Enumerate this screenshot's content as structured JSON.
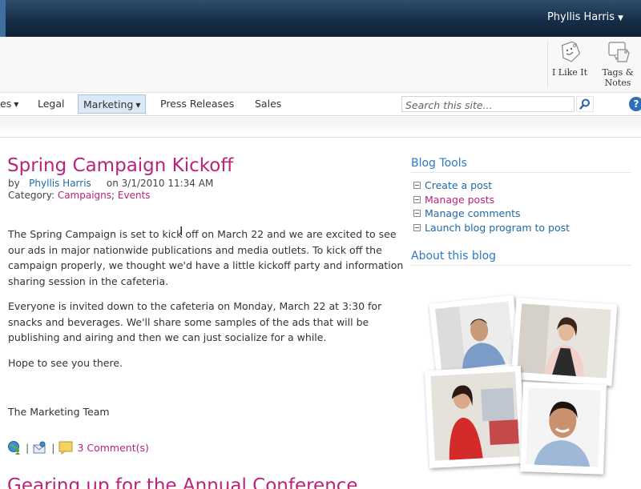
{
  "user": {
    "name": "Phyllis Harris"
  },
  "ribbon": {
    "like_label": "I Like It",
    "tags_line1": "Tags &",
    "tags_line2": "Notes"
  },
  "nav": {
    "items": [
      {
        "label": "es",
        "has_dropdown": true
      },
      {
        "label": "Legal",
        "has_dropdown": false
      },
      {
        "label": "Marketing",
        "has_dropdown": true,
        "selected": true
      },
      {
        "label": "Press Releases",
        "has_dropdown": false
      },
      {
        "label": "Sales",
        "has_dropdown": false
      }
    ]
  },
  "search": {
    "placeholder": "Search this site...",
    "help_label": "?"
  },
  "post": {
    "title": "Spring Campaign Kickoff",
    "by_label": "by",
    "author": "Phyllis Harris",
    "date_text": "on 3/1/2010 11:34 AM",
    "category_label": "Category:",
    "categories": [
      "Campaigns",
      "Events"
    ],
    "category_separator": ";",
    "paragraphs": [
      "The Spring Campaign is set to kick off on March 22 and we are excited to see our ads in major nationwide publications and media outlets. To kick off the campaign properly, we thought we'd have a little kickoff party and information sharing session in the cafeteria.",
      "Everyone is invited down to the cafeteria on Monday, March 22 at 3:30 for snacks and beverages. We'll share some samples of the ads that will be publishing and airing and then we can just socialize for a while.",
      "Hope to see you there."
    ],
    "signature": "The Marketing Team",
    "separator": "|",
    "comments_label": "3 Comment(s)"
  },
  "next_post": {
    "title": "Gearing up for the Annual Conference"
  },
  "sidebar": {
    "blog_tools_heading": "Blog Tools",
    "tools": [
      {
        "label": "Create a post",
        "color": "blue"
      },
      {
        "label": "Manage posts",
        "color": "pink"
      },
      {
        "label": "Manage comments",
        "color": "blue"
      },
      {
        "label": "Launch blog program to post",
        "color": "blue"
      }
    ],
    "about_heading": "About this blog"
  },
  "colors": {
    "accent_pink": "#b8247a",
    "link_blue": "#1f6aa5",
    "heading_blue": "#2f7ac0",
    "topbar": "#152c46",
    "nav_selected_bg": "#dbe9f6"
  },
  "icons": {
    "like": "tag-smiley-icon",
    "tags": "tags-notes-icon",
    "search": "magnifier-icon",
    "help": "help-icon",
    "actions": [
      "globe-user-icon",
      "email-icon",
      "comment-icon"
    ]
  }
}
